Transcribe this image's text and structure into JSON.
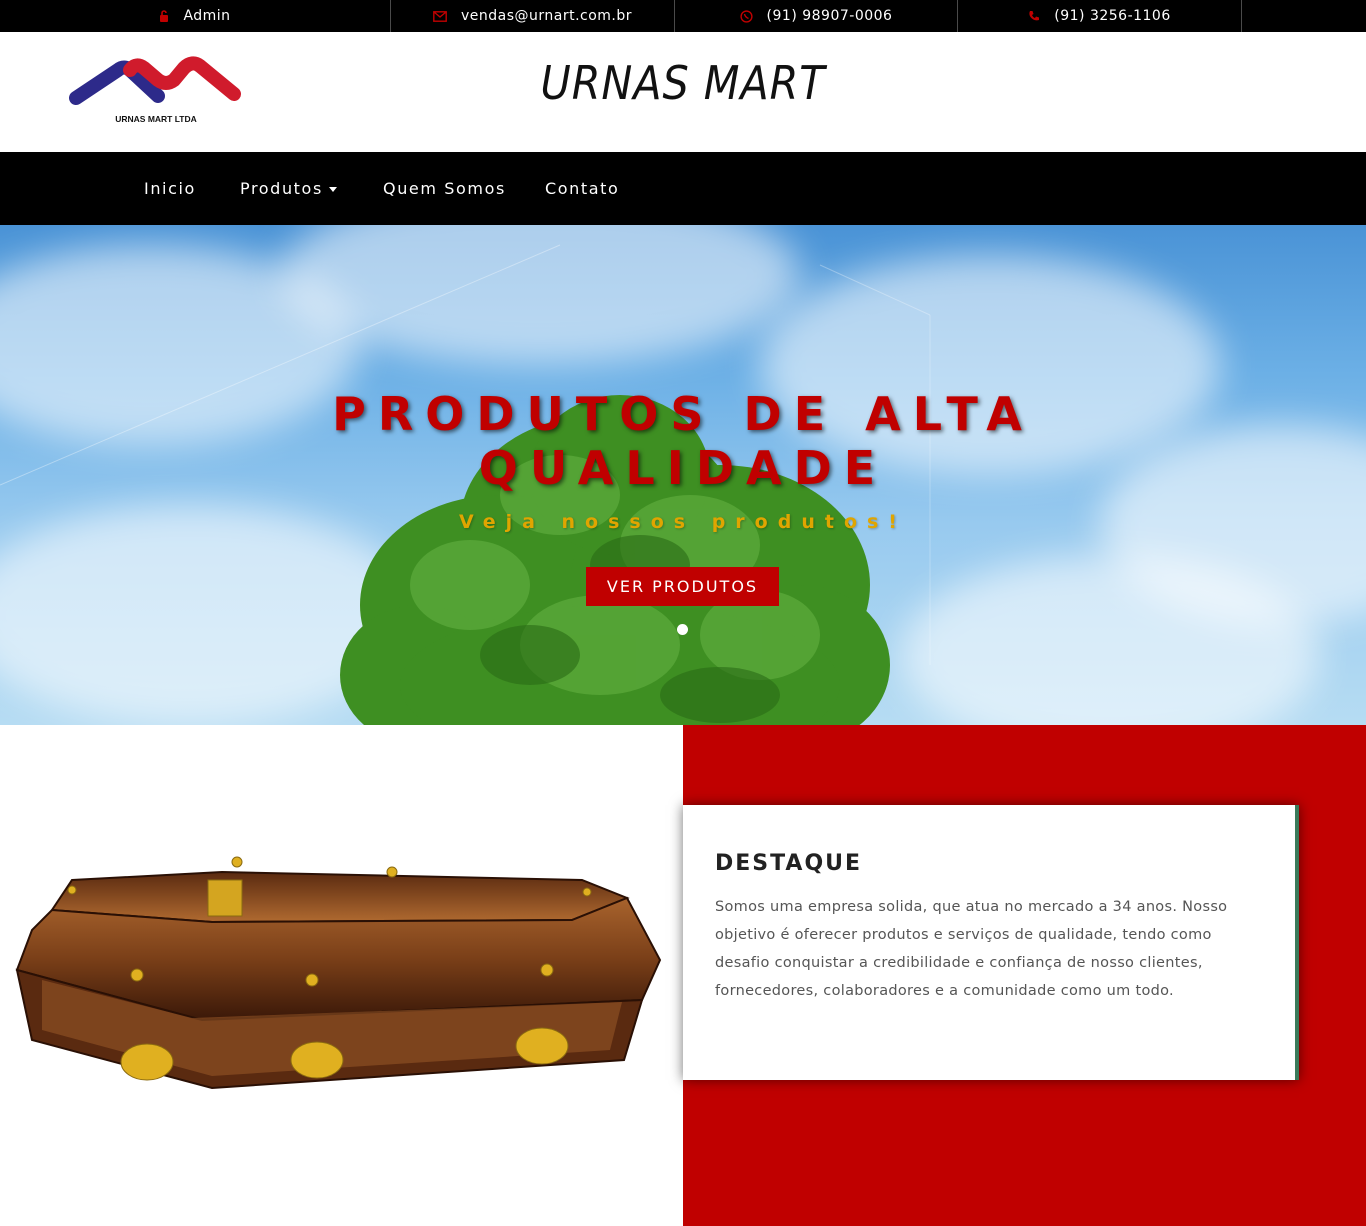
{
  "topbar": {
    "items": [
      {
        "icon": "lock-icon",
        "label": "Admin"
      },
      {
        "icon": "envelope-icon",
        "label": "vendas@urnart.com.br"
      },
      {
        "icon": "whatsapp-icon",
        "label": "(91) 98907-0006"
      },
      {
        "icon": "phone-icon",
        "label": "(91) 3256-1106"
      }
    ]
  },
  "header": {
    "logo_text": "URNAS MART LTDA",
    "title": "URNAS MART"
  },
  "nav": {
    "items": [
      "Inicio",
      "Produtos",
      "Quem Somos",
      "Contato"
    ]
  },
  "hero": {
    "title_line1": "PRODUTOS DE ALTA",
    "title_line2": "QUALIDADE",
    "subtitle": "Veja nossos produtos!",
    "button": "VER PRODUTOS"
  },
  "feature": {
    "title": "DESTAQUE",
    "text": "Somos uma empresa solida, que atua no mercado a 34 anos. Nosso objetivo é oferecer produtos e serviços de qualidade, tendo como desafio conquistar a credibilidade e confiança de nosso clientes, fornecedores, colaboradores e a comunidade como um todo."
  },
  "colors": {
    "accent": "#c00000",
    "navbar": "#000000",
    "subtitle": "#e0a500"
  }
}
